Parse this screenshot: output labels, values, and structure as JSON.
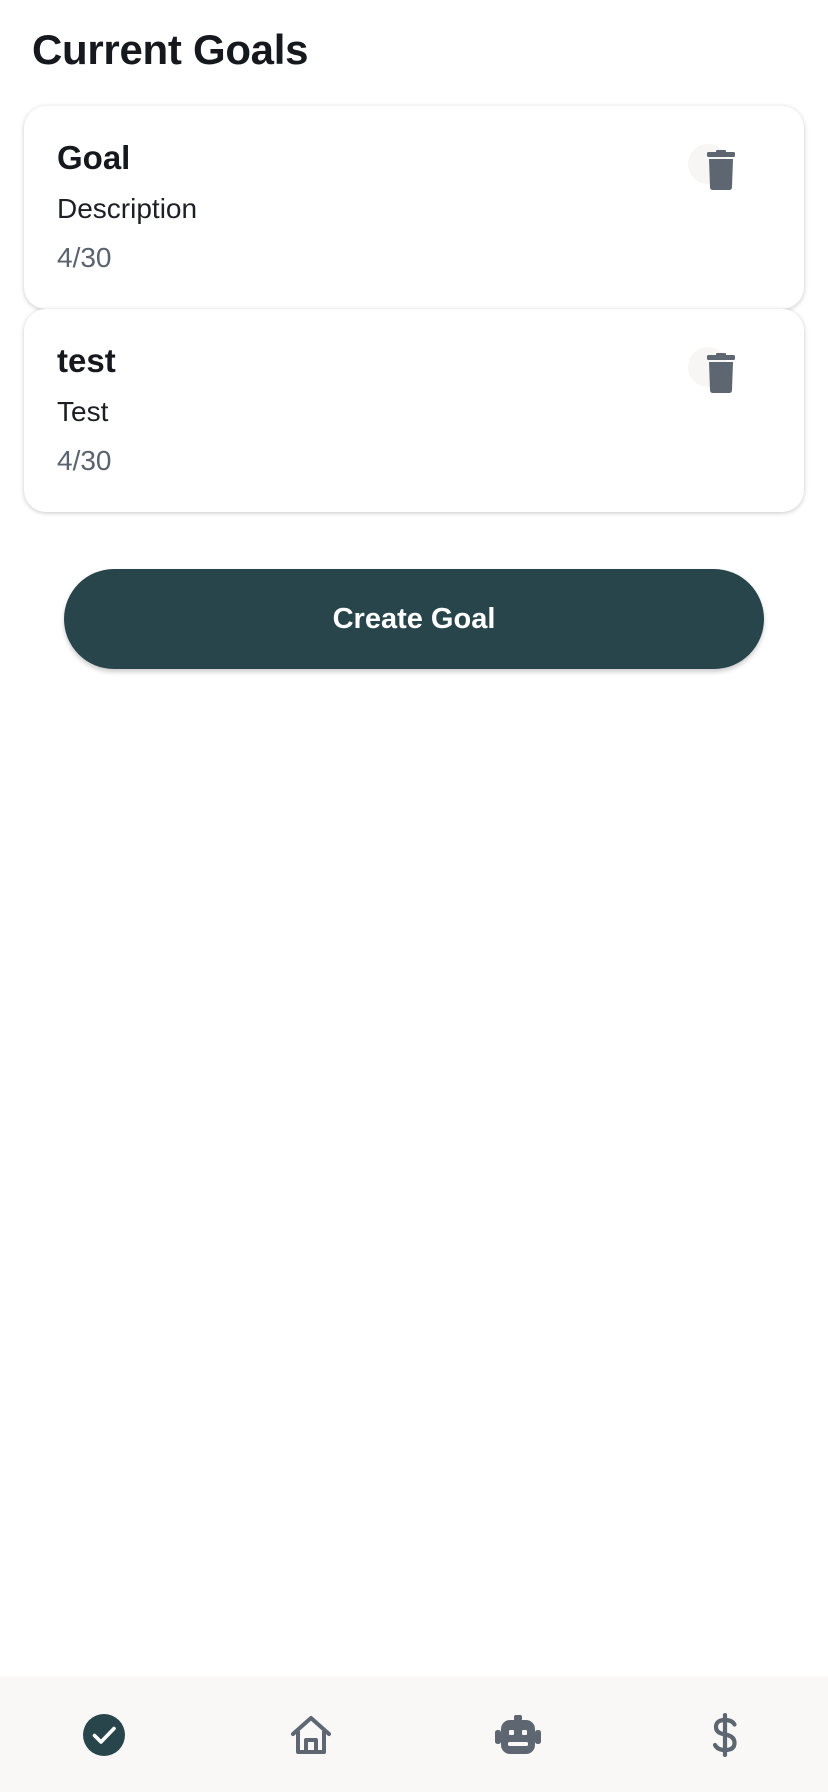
{
  "header": {
    "title": "Current Goals"
  },
  "goals": [
    {
      "title": "Goal",
      "description": "Description",
      "progress": "4/30",
      "delete_icon": "trash-icon"
    },
    {
      "title": "test",
      "description": "Test",
      "progress": "4/30",
      "delete_icon": "trash-icon"
    }
  ],
  "actions": {
    "create_goal_label": "Create Goal"
  },
  "bottom_nav": {
    "items": [
      {
        "icon": "check-circle-icon",
        "active": true
      },
      {
        "icon": "home-icon",
        "active": false
      },
      {
        "icon": "robot-icon",
        "active": false
      },
      {
        "icon": "dollar-icon",
        "active": false
      }
    ]
  },
  "colors": {
    "primary": "#27454b",
    "icon_gray": "#5d6671",
    "nav_background": "#f9f8f6"
  }
}
